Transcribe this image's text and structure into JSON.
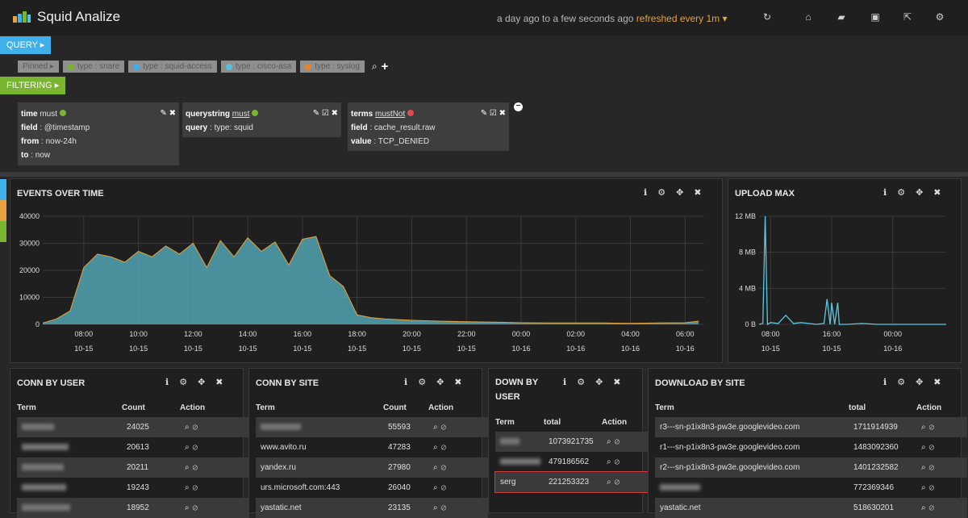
{
  "app": {
    "title": "Squid Analize"
  },
  "timepicker": {
    "range": "a day ago to a few seconds ago",
    "refresh": "refreshed every 1m"
  },
  "query": {
    "label": "QUERY ▸"
  },
  "filtering": {
    "label": "FILTERING ▸"
  },
  "pins": [
    {
      "label": "Pinned ▸",
      "color": ""
    },
    {
      "label": "type : snare",
      "color": "#7ab532"
    },
    {
      "label": "type : squid-access",
      "color": "#3fb0e9"
    },
    {
      "label": "type : cisco-asa",
      "color": "#5bc0de"
    },
    {
      "label": "type : syslog",
      "color": "#e6832a"
    }
  ],
  "filters": [
    {
      "title": "time",
      "mode": "must",
      "status": "#7ab532",
      "rows": [
        [
          "field",
          "@timestamp"
        ],
        [
          "from",
          "now-24h"
        ],
        [
          "to",
          "now"
        ]
      ]
    },
    {
      "title": "querystring",
      "mode": "must",
      "status": "#7ab532",
      "rows": [
        [
          "query",
          "type: squid"
        ]
      ]
    },
    {
      "title": "terms",
      "mode": "mustNot",
      "status": "#e24b4b",
      "rows": [
        [
          "field",
          "cache_result.raw"
        ],
        [
          "value",
          "TCP_DENIED"
        ]
      ]
    }
  ],
  "panels": {
    "events": {
      "title": "EVENTS OVER TIME"
    },
    "upload": {
      "title": "UPLOAD MAX"
    },
    "conn_user": {
      "title": "CONN BY USER",
      "cols": [
        "Term",
        "Count",
        "Action"
      ],
      "rows": [
        [
          "",
          "24025"
        ],
        [
          "",
          "20613"
        ],
        [
          "",
          "20211"
        ],
        [
          "",
          "19243"
        ],
        [
          "",
          "18952"
        ]
      ]
    },
    "conn_site": {
      "title": "CONN BY SITE",
      "cols": [
        "Term",
        "Count",
        "Action"
      ],
      "rows": [
        [
          "",
          "55593"
        ],
        [
          "www.avito.ru",
          "47283"
        ],
        [
          "yandex.ru",
          "27980"
        ],
        [
          "urs.microsoft.com:443",
          "26040"
        ],
        [
          "yastatic.net",
          "23135"
        ]
      ]
    },
    "down_user": {
      "title": "DOWN BY USER",
      "title2": "USER",
      "cols": [
        "Term",
        "total",
        "Action"
      ],
      "rows": [
        [
          "",
          "1073921735"
        ],
        [
          "",
          "479186562"
        ],
        [
          "serg",
          "221253323"
        ]
      ]
    },
    "download_site": {
      "title": "DOWNLOAD BY SITE",
      "cols": [
        "Term",
        "total",
        "Action"
      ],
      "rows": [
        [
          "r3---sn-p1ix8n3-pw3e.googlevideo.com",
          "1711914939"
        ],
        [
          "r1---sn-p1ix8n3-pw3e.googlevideo.com",
          "1483092360"
        ],
        [
          "r2---sn-p1ix8n3-pw3e.googlevideo.com",
          "1401232582"
        ],
        [
          "",
          "772369346"
        ],
        [
          "yastatic.net",
          "518630201"
        ]
      ]
    }
  },
  "chart_data": [
    {
      "type": "area",
      "title": "EVENTS OVER TIME",
      "ylim": [
        0,
        40000
      ],
      "yticks": [
        "40000",
        "30000",
        "20000",
        "10000",
        "0"
      ],
      "xticks": [
        [
          "08:00",
          "10-15"
        ],
        [
          "10:00",
          "10-15"
        ],
        [
          "12:00",
          "10-15"
        ],
        [
          "14:00",
          "10-15"
        ],
        [
          "16:00",
          "10-15"
        ],
        [
          "18:00",
          "10-15"
        ],
        [
          "20:00",
          "10-15"
        ],
        [
          "22:00",
          "10-15"
        ],
        [
          "00:00",
          "10-16"
        ],
        [
          "02:00",
          "10-16"
        ],
        [
          "04:00",
          "10-16"
        ],
        [
          "06:00",
          "10-16"
        ]
      ],
      "x_hours": [
        6.5,
        7,
        7.5,
        8,
        8.5,
        9,
        9.5,
        10,
        10.5,
        11,
        11.5,
        12,
        12.5,
        13,
        13.5,
        14,
        14.5,
        15,
        15.5,
        16,
        16.5,
        17,
        17.5,
        18,
        18.5,
        19,
        20,
        21,
        22,
        23,
        24,
        25,
        26,
        27,
        28,
        29,
        30,
        30.5
      ],
      "values": [
        500,
        2000,
        5000,
        21000,
        26000,
        25000,
        23000,
        27000,
        25000,
        29000,
        26000,
        30000,
        21000,
        31000,
        25000,
        32000,
        27000,
        30500,
        22000,
        31500,
        32500,
        18000,
        14000,
        3500,
        2500,
        2000,
        1500,
        1200,
        1000,
        800,
        600,
        500,
        500,
        500,
        400,
        500,
        600,
        1200
      ],
      "color": "#52a4b3"
    },
    {
      "type": "line",
      "title": "UPLOAD MAX",
      "ylim": [
        0,
        12
      ],
      "yticks": [
        "12 MB",
        "8 MB",
        "4 MB",
        "0 B"
      ],
      "xticks": [
        [
          "08:00",
          "10-15"
        ],
        [
          "16:00",
          "10-15"
        ],
        [
          "00:00",
          "10-16"
        ]
      ],
      "x_hours": [
        6.5,
        7,
        7.3,
        7.6,
        8,
        9,
        10,
        11,
        12,
        13,
        14,
        15,
        15.4,
        15.8,
        16,
        16.4,
        16.8,
        17,
        17.5,
        18,
        20,
        22,
        24,
        26,
        28,
        30,
        31
      ],
      "values": [
        0,
        0.1,
        12,
        0,
        0.2,
        0.1,
        1,
        0.1,
        0.2,
        0.1,
        0,
        0.1,
        2.8,
        0,
        2.4,
        0,
        2.4,
        0,
        0,
        0,
        0.1,
        0,
        0,
        0,
        0,
        0,
        0
      ],
      "color": "#5bc8e0"
    }
  ]
}
